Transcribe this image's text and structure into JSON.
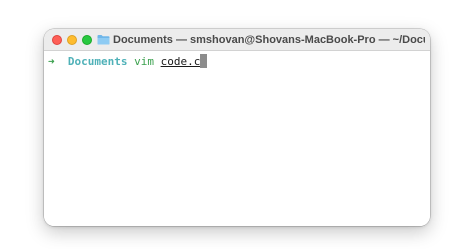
{
  "window": {
    "title": "Documents — smshovan@Shovans-MacBook-Pro — ~/Docu…",
    "title_icon": "folder-icon",
    "traffic_lights": {
      "close_color": "#fe5f57",
      "minimize_color": "#febc2e",
      "maximize_color": "#28c840"
    }
  },
  "terminal": {
    "prompt_symbol": "➜",
    "cwd": "Documents",
    "command": "vim",
    "argument": "code.c",
    "colors": {
      "prompt": "#3aa04d",
      "cwd": "#4fb1b8",
      "cursor": "#8c8c8c"
    }
  }
}
